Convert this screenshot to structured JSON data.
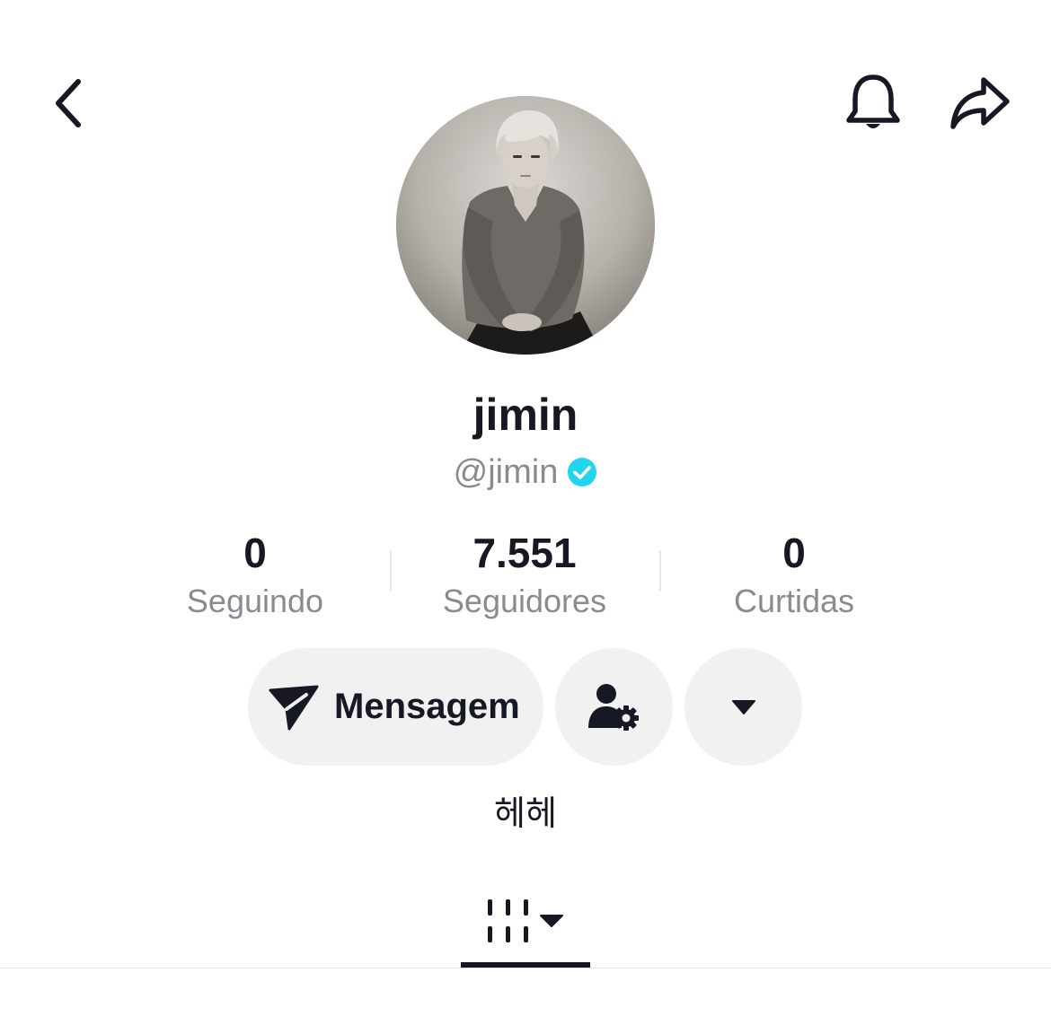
{
  "header": {
    "back_icon": "chevron-left-icon",
    "notification_icon": "bell-icon",
    "share_icon": "share-arrow-icon"
  },
  "profile": {
    "display_name": "jimin",
    "handle": "@jimin",
    "verified": true,
    "verified_color": "#20d5ec",
    "avatar": "profile-photo"
  },
  "stats": [
    {
      "value": "0",
      "label": "Seguindo"
    },
    {
      "value": "7.551",
      "label": "Seguidores"
    },
    {
      "value": "0",
      "label": "Curtidas"
    }
  ],
  "actions": {
    "message_label": "Mensagem",
    "message_icon": "send-icon",
    "follow_settings_icon": "user-settings-icon",
    "more_icon": "caret-down-icon"
  },
  "bio": "헤헤",
  "tabs": [
    {
      "icon": "video-grid-icon",
      "active": true,
      "has_dropdown": true
    }
  ],
  "colors": {
    "text_primary": "#161823",
    "text_secondary": "#8a8b91",
    "button_bg": "#f1f1f2"
  }
}
